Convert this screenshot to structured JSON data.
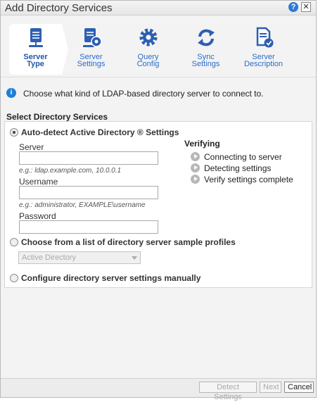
{
  "window": {
    "title": "Add Directory Services",
    "help_glyph": "?",
    "close_glyph": "✕"
  },
  "steps": [
    {
      "line1": "Server",
      "line2": "Type",
      "icon": "server-icon",
      "active": true
    },
    {
      "line1": "Server",
      "line2": "Settings",
      "icon": "server-settings-icon",
      "active": false
    },
    {
      "line1": "Query",
      "line2": "Config",
      "icon": "gear-icon",
      "active": false
    },
    {
      "line1": "Sync",
      "line2": "Settings",
      "icon": "sync-icon",
      "active": false
    },
    {
      "line1": "Server",
      "line2": "Description",
      "icon": "document-check-icon",
      "active": false
    }
  ],
  "info": {
    "icon_glyph": "i",
    "text": "Choose what kind of LDAP-based directory server to connect to."
  },
  "section_title": "Select Directory Services",
  "options": {
    "auto_detect": "Auto-detect Active Directory ® Settings",
    "sample_profiles": "Choose from a list of directory server sample profiles",
    "manual": "Configure directory server settings manually"
  },
  "fields": {
    "server_label": "Server",
    "server_value": "",
    "server_hint": "e.g.: ldap.example.com, 10.0.0.1",
    "username_label": "Username",
    "username_value": "",
    "username_hint": "e.g.: administrator, EXAMPLE\\username",
    "password_label": "Password",
    "password_value": ""
  },
  "verifying": {
    "title": "Verifying",
    "items": [
      "Connecting to server",
      "Detecting settings",
      "Verify settings complete"
    ]
  },
  "profile_select": {
    "selected": "Active Directory"
  },
  "footer": {
    "detect": "Detect Settings",
    "next": "Next",
    "cancel": "Cancel"
  },
  "colors": {
    "accent": "#2b6cc6",
    "info": "#1e7fd8",
    "panel": "#ffffff",
    "background": "#f3f3f3"
  }
}
